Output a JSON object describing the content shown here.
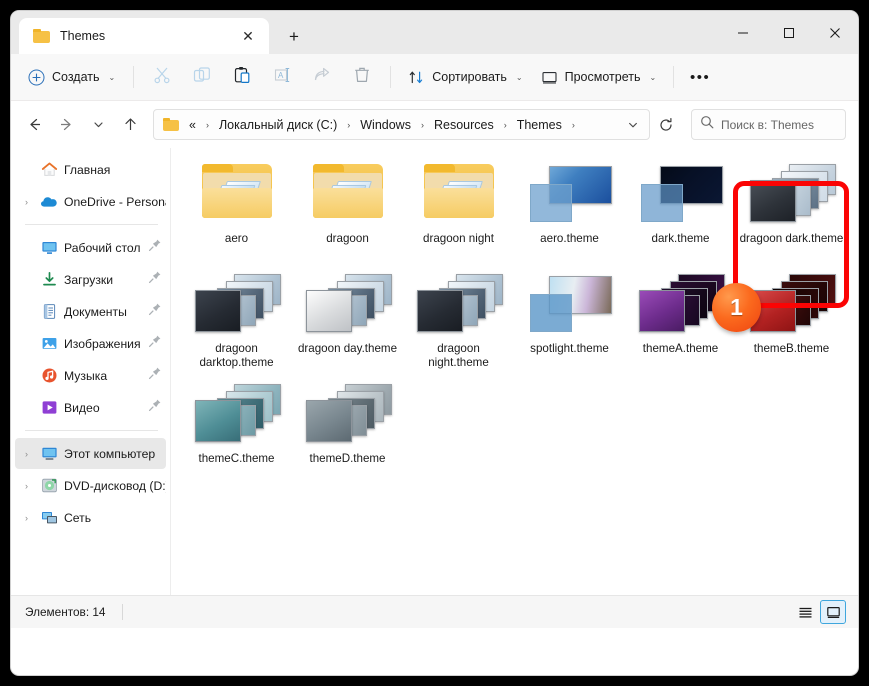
{
  "window": {
    "tab_title": "Themes",
    "tab_close_label": "✕",
    "new_tab_label": "+",
    "minimize_label": "—",
    "maximize_label": "□",
    "close_label": "✕"
  },
  "toolbar": {
    "new_label": "Создать",
    "sort_label": "Сортировать",
    "view_label": "Просмотреть",
    "more_label": "•••",
    "icons": [
      {
        "name": "cut-icon",
        "enabled": false
      },
      {
        "name": "copy-icon",
        "enabled": false
      },
      {
        "name": "paste-icon",
        "enabled": true
      },
      {
        "name": "rename-icon",
        "enabled": false
      },
      {
        "name": "share-icon",
        "enabled": false
      },
      {
        "name": "delete-icon",
        "enabled": false
      }
    ]
  },
  "address": {
    "back_label": "←",
    "forward_label": "→",
    "recent_label": "⌄",
    "up_label": "↑",
    "prefix": "«",
    "crumbs": [
      "Локальный диск (C:)",
      "Windows",
      "Resources",
      "Themes"
    ],
    "separator": "›",
    "dropdown_label": "⌄"
  },
  "search": {
    "placeholder": "Поиск в: Themes"
  },
  "sidebar": {
    "items": [
      {
        "label": "Главная",
        "icon": "home-icon",
        "expandable": false,
        "pinned": false,
        "selected": false
      },
      {
        "label": "OneDrive - Persona",
        "icon": "onedrive-icon",
        "expandable": true,
        "pinned": false,
        "selected": false
      },
      {
        "divider": true
      },
      {
        "label": "Рабочий стол",
        "icon": "desktop-icon",
        "expandable": false,
        "pinned": true,
        "selected": false
      },
      {
        "label": "Загрузки",
        "icon": "downloads-icon",
        "expandable": false,
        "pinned": true,
        "selected": false
      },
      {
        "label": "Документы",
        "icon": "documents-icon",
        "expandable": false,
        "pinned": true,
        "selected": false
      },
      {
        "label": "Изображения",
        "icon": "pictures-icon",
        "expandable": false,
        "pinned": true,
        "selected": false
      },
      {
        "label": "Музыка",
        "icon": "music-icon",
        "expandable": false,
        "pinned": true,
        "selected": false
      },
      {
        "label": "Видео",
        "icon": "video-icon",
        "expandable": false,
        "pinned": true,
        "selected": false
      },
      {
        "divider": true
      },
      {
        "label": "Этот компьютер",
        "icon": "this-pc-icon",
        "expandable": true,
        "pinned": false,
        "selected": true
      },
      {
        "label": "DVD-дисковод (D:)",
        "icon": "dvd-drive-icon",
        "expandable": true,
        "pinned": false,
        "selected": false
      },
      {
        "label": "Сеть",
        "icon": "network-icon",
        "expandable": true,
        "pinned": false,
        "selected": false
      }
    ]
  },
  "files": [
    {
      "name": "aero",
      "type": "folder"
    },
    {
      "name": "dragoon",
      "type": "folder"
    },
    {
      "name": "dragoon night",
      "type": "folder"
    },
    {
      "name": "aero.theme",
      "type": "theme-simple",
      "wall": "linear-gradient(135deg,#6fa8d8 0%,#3f7fc0 35%,#1b4f9e 100%)",
      "sq": "rgba(110,160,205,.75)"
    },
    {
      "name": "dark.theme",
      "type": "theme-simple",
      "wall": "linear-gradient(135deg,#040b18 0%,#071026 40%,#0a1733 100%)",
      "sq": "rgba(95,150,200,.7)"
    },
    {
      "name": "dragoon dark.theme",
      "type": "theme-stack",
      "main": "linear-gradient(150deg,#4a5058 0%,#2e333a 55%,#1d2127 100%)",
      "layers": [
        "linear-gradient(120deg,#e9eef3,#b9c9d7)",
        "linear-gradient(120deg,#f4f7fa,#cfdbe6)",
        "linear-gradient(120deg,#9fb3c4,#5c7084)",
        "linear-gradient(120deg,#dde6ee,#aabccb)"
      ],
      "highlighted": true
    },
    {
      "name": "dragoon darktop.theme",
      "type": "theme-stack",
      "main": "linear-gradient(150deg,#3c434d 0%,#262b33 55%,#191d23 100%)",
      "layers": [
        "linear-gradient(120deg,#d7e3ec,#9db4c7)",
        "linear-gradient(120deg,#f0f5f9,#c3d3e0)",
        "linear-gradient(120deg,#7e93a6,#3f5062)",
        "linear-gradient(120deg,#cfdae4,#8fa6b8)"
      ]
    },
    {
      "name": "dragoon day.theme",
      "type": "theme-stack",
      "main": "linear-gradient(150deg,#fdfdfd 0%,#d9dbdd 55%,#bfc2c6 100%)",
      "layers": [
        "linear-gradient(120deg,#d7e3ec,#9db4c7)",
        "linear-gradient(120deg,#f0f5f9,#c3d3e0)",
        "linear-gradient(120deg,#7e93a6,#3f5062)",
        "linear-gradient(120deg,#cfdae4,#8fa6b8)"
      ]
    },
    {
      "name": "dragoon night.theme",
      "type": "theme-stack",
      "main": "linear-gradient(150deg,#3c434d 0%,#262b33 55%,#191d23 100%)",
      "layers": [
        "linear-gradient(120deg,#d7e3ec,#9db4c7)",
        "linear-gradient(120deg,#f0f5f9,#c3d3e0)",
        "linear-gradient(120deg,#7e93a6,#3f5062)",
        "linear-gradient(120deg,#cfdae4,#8fa6b8)"
      ]
    },
    {
      "name": "spotlight.theme",
      "type": "theme-simple",
      "wall": "linear-gradient(100deg,#bfe0f2 0%,#e8eef2 38%,#cbb6d8 62%,#7a6a58 100%)",
      "sq": "rgba(90,150,200,.8)"
    },
    {
      "name": "themeA.theme",
      "type": "theme-stack",
      "main": "linear-gradient(150deg,#9a4bb8 0%,#6d2c8c 55%,#4a1c63 100%)",
      "layers": [
        "linear-gradient(120deg,#1b0a22,#3d1048)",
        "linear-gradient(120deg,#2a0c32,#140617)",
        "linear-gradient(120deg,#24102e,#0d0512)",
        "linear-gradient(120deg,#3a1246,#170820)"
      ]
    },
    {
      "name": "themeB.theme",
      "type": "theme-stack",
      "main": "linear-gradient(150deg,#d94a4a 0%,#b32222 55%,#8e1414 100%)",
      "layers": [
        "linear-gradient(120deg,#2a0808,#511010)",
        "linear-gradient(120deg,#3a0c0c,#1a0404)",
        "linear-gradient(120deg,#120303,#2e0707)",
        "linear-gradient(120deg,#5a1212,#200606)"
      ]
    },
    {
      "name": "themeC.theme",
      "type": "theme-stack",
      "main": "linear-gradient(150deg,#7fb4b8 0%,#4f8e96 55%,#386e78 100%)",
      "layers": [
        "linear-gradient(120deg,#bcd4da,#7aa6b2)",
        "linear-gradient(120deg,#d7e6ea,#9cc0c8)",
        "linear-gradient(120deg,#5f8d96,#2f5d68)",
        "linear-gradient(120deg,#a9c9d0,#6d9aa4)"
      ]
    },
    {
      "name": "themeD.theme",
      "type": "theme-stack",
      "main": "linear-gradient(150deg,#9aa6ac 0%,#78868e 55%,#5d6a72 100%)",
      "layers": [
        "linear-gradient(120deg,#c6ced2,#8e9aa1)",
        "linear-gradient(120deg,#dfe5e8,#aab5bb)",
        "linear-gradient(120deg,#7e8b92,#4e5b63)",
        "linear-gradient(120deg,#b5c0c6,#808e96)"
      ]
    }
  ],
  "status": {
    "items_count_label": "Элементов: 14"
  },
  "view_buttons": {
    "list_label": "list-view",
    "tiles_label": "tiles-view",
    "active": "tiles-view"
  },
  "annotation": {
    "badge_number": "1",
    "highlight_color": "#fb0404",
    "badge_color": "#ef4310",
    "target_file": "dragoon dark.theme"
  }
}
